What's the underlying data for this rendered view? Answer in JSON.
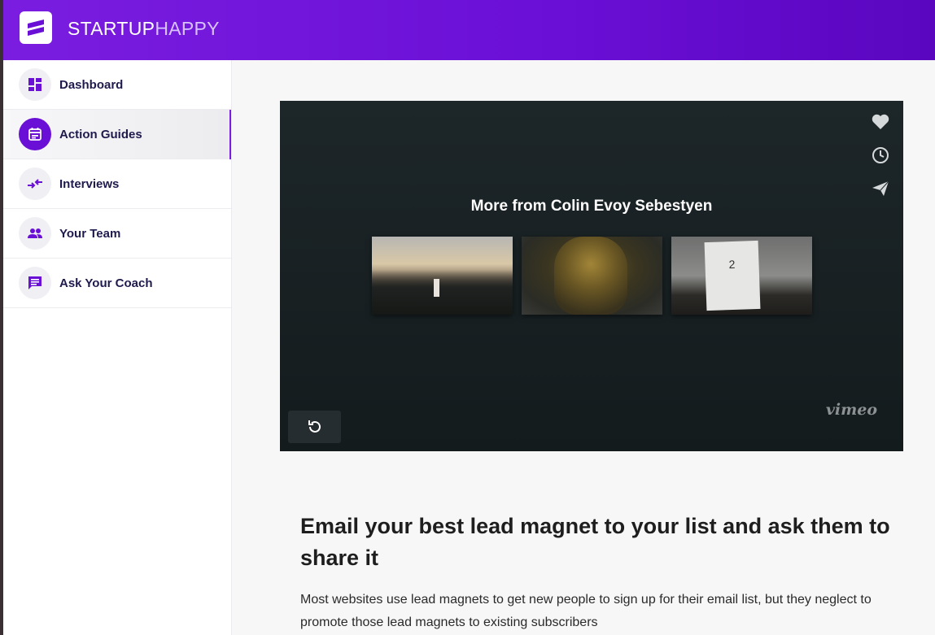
{
  "brand": {
    "part1": "STARTUP",
    "part2": "HAPPY"
  },
  "sidebar": {
    "items": [
      {
        "label": "Dashboard",
        "icon": "dashboard-icon"
      },
      {
        "label": "Action Guides",
        "icon": "calendar-icon",
        "active": true
      },
      {
        "label": "Interviews",
        "icon": "swap-arrows-icon"
      },
      {
        "label": "Your Team",
        "icon": "people-icon"
      },
      {
        "label": "Ask Your Coach",
        "icon": "chat-icon"
      }
    ]
  },
  "video": {
    "more_title": "More from Colin Evoy Sebestyen",
    "thumbnails": [
      "lighthouse-sunset",
      "gold-face",
      "handwritten-sign"
    ],
    "thumb3_number": "2",
    "logo": "vimeo",
    "side_icons": [
      "heart-icon",
      "clock-icon",
      "send-icon"
    ],
    "replay_icon": "replay-icon"
  },
  "article": {
    "title": "Email your best lead magnet to your list and ask them to share it",
    "body": "Most websites use lead magnets to get new people to sign up for their email list, but they neglect to promote those lead magnets to existing subscribers"
  },
  "colors": {
    "accent": "#6a0fd6",
    "nav_text": "#1e1a4d"
  }
}
